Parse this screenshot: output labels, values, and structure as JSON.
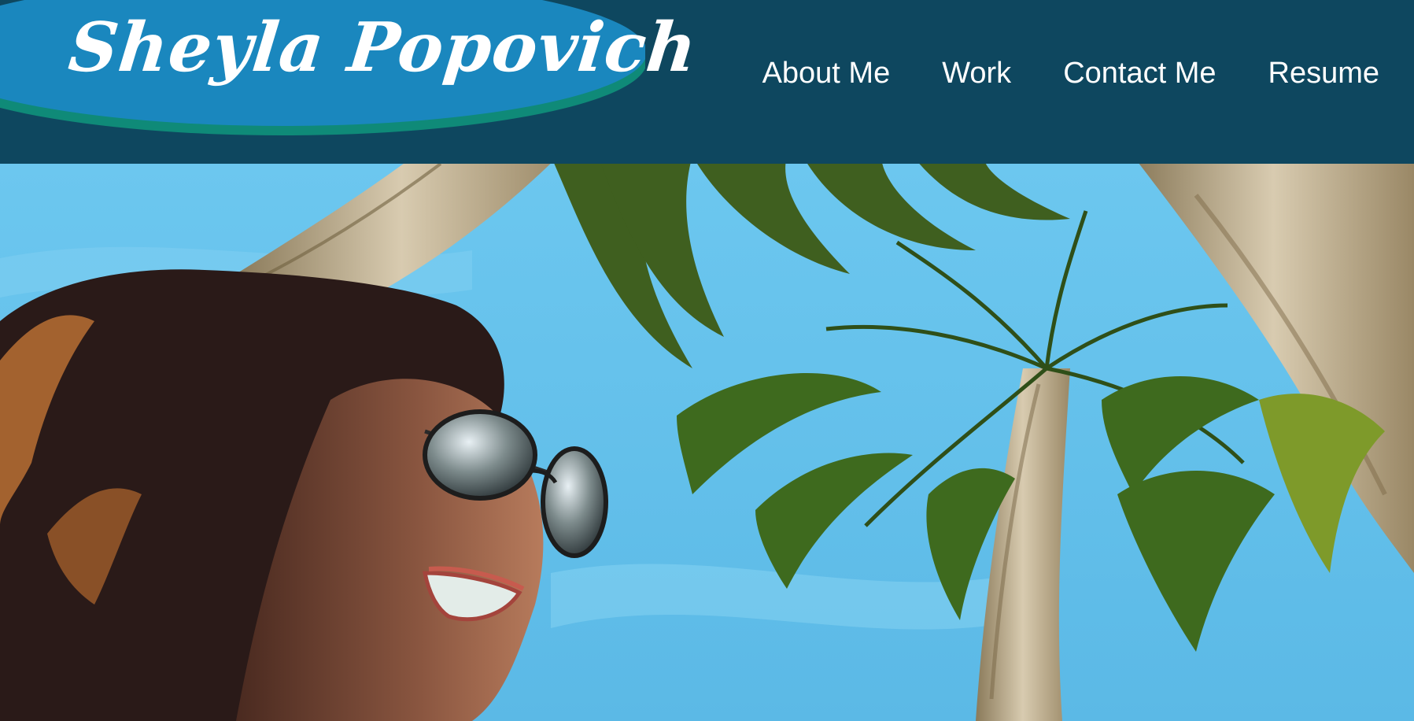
{
  "site": {
    "title": "Sheyla Popovich"
  },
  "nav": {
    "items": [
      {
        "label": "About Me"
      },
      {
        "label": "Work"
      },
      {
        "label": "Contact Me"
      },
      {
        "label": "Resume"
      }
    ]
  },
  "colors": {
    "header_bg": "#0e475f",
    "logo_blue": "#1a87be",
    "logo_teal": "#0f8a78",
    "sky": "#57bde8"
  },
  "hero": {
    "image_subject": "selfie-under-palm-trees"
  }
}
